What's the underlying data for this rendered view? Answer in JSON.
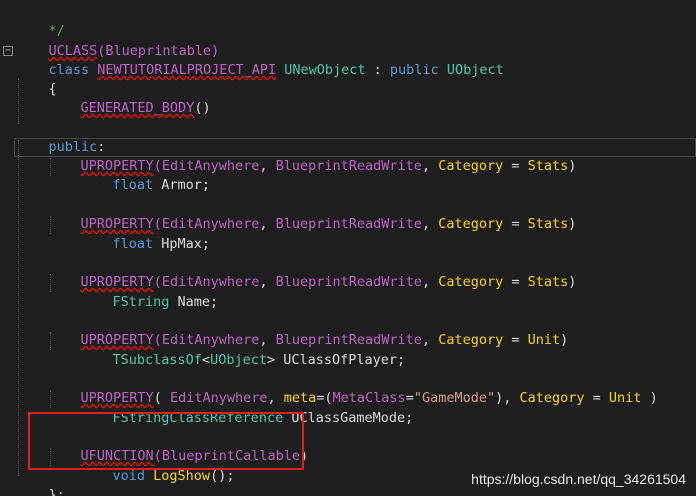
{
  "editor": {
    "lines": {
      "l0": {
        "comment": "*/"
      },
      "l1": {
        "macro": "UCLASS",
        "args": "(Blueprintable)"
      },
      "l2": {
        "kw": "class",
        "api": "NEWTUTORIALPROJECT_API",
        "name": "UNewObject",
        "sep": " : ",
        "access": "public",
        "base": "UObject"
      },
      "l3": {
        "brace": "{"
      },
      "l4": {
        "macro": "GENERATED_BODY",
        "parens": "()"
      },
      "l5": {
        "kw": "public",
        "colon": ":"
      },
      "p1": {
        "macro": "UPROPERTY",
        "open": "(",
        "a1": "EditAnywhere",
        "c1": ", ",
        "a2": "BlueprintReadWrite",
        "c2": ", ",
        "a3": "Category",
        "eq": " = ",
        "a4": "Stats",
        "close": ")"
      },
      "d1": {
        "type": "float",
        "name": " Armor;"
      },
      "p2": {
        "macro": "UPROPERTY",
        "open": "(",
        "a1": "EditAnywhere",
        "c1": ", ",
        "a2": "BlueprintReadWrite",
        "c2": ", ",
        "a3": "Category",
        "eq": " = ",
        "a4": "Stats",
        "close": ")"
      },
      "d2": {
        "type": "float",
        "name": " HpMax;"
      },
      "p3": {
        "macro": "UPROPERTY",
        "open": "(",
        "a1": "EditAnywhere",
        "c1": ", ",
        "a2": "BlueprintReadWrite",
        "c2": ", ",
        "a3": "Category",
        "eq": " = ",
        "a4": "Stats",
        "close": ")"
      },
      "d3": {
        "type": "FString",
        "name": " Name;"
      },
      "p4": {
        "macro": "UPROPERTY",
        "open": "(",
        "a1": "EditAnywhere",
        "c1": ", ",
        "a2": "BlueprintReadWrite",
        "c2": ", ",
        "a3": "Category",
        "eq": " = ",
        "a4": "Unit",
        "close": ")"
      },
      "d4": {
        "type": "TSubclassOf",
        "lt": "<",
        "targ": "UObject",
        "gt": ">",
        "name": " UClassOfPlayer;"
      },
      "p5": {
        "macro": "UPROPERTY",
        "open": "( ",
        "a1": "EditAnywhere",
        "c1": ", ",
        "meta": "meta",
        "eq1": "=(",
        "mc": "MetaClass",
        "eq2": "=",
        "str": "\"GameMode\"",
        "close1": "), ",
        "a3": "Category",
        "eq": " = ",
        "a4": "Unit",
        "close": " )"
      },
      "d5": {
        "type": "FStringClassReference",
        "name": " UClassGameMode;"
      },
      "f1": {
        "macro": "UFUNCTION",
        "open": "(",
        "a1": "BlueprintCallable",
        "close": ")"
      },
      "f2": {
        "kw": "void",
        "name": " LogShow",
        "rest": "();"
      },
      "end": {
        "text": "};"
      }
    }
  },
  "watermark": "https://blog.csdn.net/qq_34261504",
  "colors": {
    "background": "#1e1e1e",
    "macro": "#bd63c5",
    "keyword": "#569cd6",
    "type": "#4ec9b0",
    "highlight_box": "#e02020"
  }
}
